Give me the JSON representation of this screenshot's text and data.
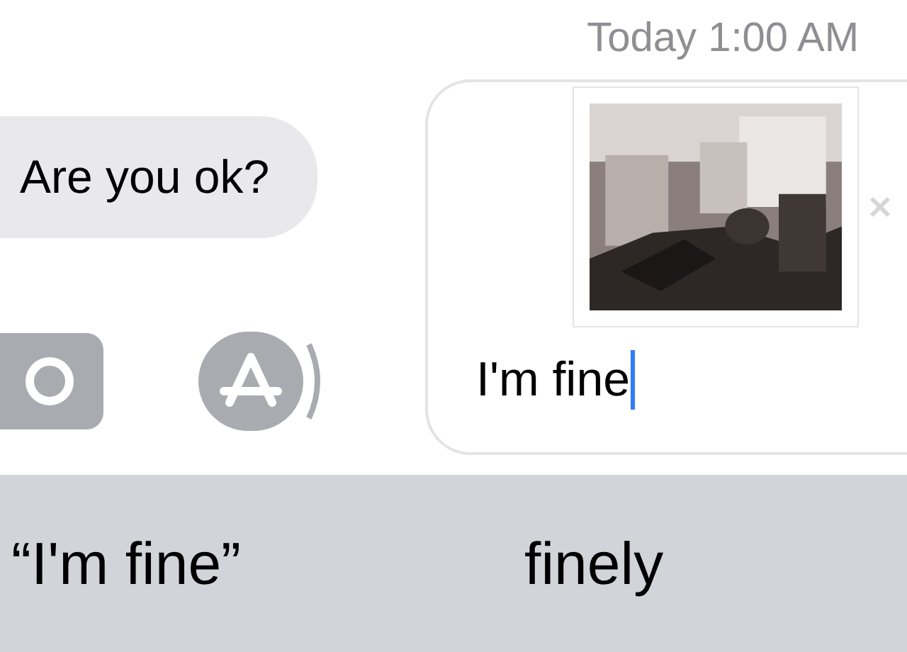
{
  "timestamp": "Today 1:00 AM",
  "messages": [
    {
      "text": "Are you ok?",
      "kind": "incoming"
    }
  ],
  "compose": {
    "value": "I'm fine"
  },
  "suggestions": [
    {
      "text": "“I'm fine”"
    },
    {
      "text": "finely"
    }
  ]
}
